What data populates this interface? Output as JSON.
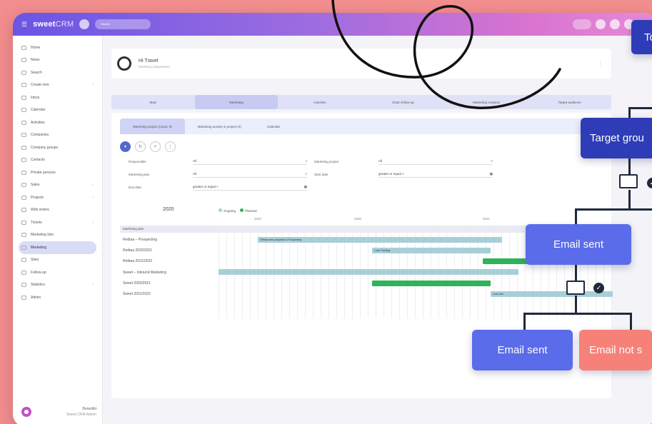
{
  "app": {
    "brand_bold": "sweet",
    "brand_light": "CRM",
    "search_placeholder": "Search"
  },
  "sidebar": {
    "items": [
      {
        "label": "Home"
      },
      {
        "label": "News"
      },
      {
        "label": "Search"
      },
      {
        "label": "Create new"
      },
      {
        "label": "Inbox"
      },
      {
        "label": "Calendar"
      },
      {
        "label": "Activities"
      },
      {
        "label": "Companies"
      },
      {
        "label": "Company groups"
      },
      {
        "label": "Contacts"
      },
      {
        "label": "Private persons"
      },
      {
        "label": "Sales"
      },
      {
        "label": "Projects"
      },
      {
        "label": "Web orders"
      },
      {
        "label": "Tickets"
      },
      {
        "label": "Marketing lists"
      },
      {
        "label": "Marketing"
      },
      {
        "label": "Sites"
      },
      {
        "label": "Follow-up"
      },
      {
        "label": "Statistics"
      },
      {
        "label": "Admin"
      }
    ],
    "user_name": "Benedikt",
    "user_sub": "Sweet CRM Admin"
  },
  "header": {
    "title": "Hi Travel",
    "subtitle": "Marketing department"
  },
  "tabs": [
    "Main",
    "Marketing",
    "Activities",
    "Chain follow-up",
    "Marketing contacts",
    "Target audience"
  ],
  "subtabs": [
    "Marketing project (count: 6)",
    "Marketing activity in project (4)",
    "Calendar"
  ],
  "filters": {
    "responsible_label": "Responsible",
    "responsible_value": "All",
    "project_label": "Marketing project",
    "project_value": "All",
    "plan_label": "Marketing plan",
    "plan_value": "All",
    "start_label": "Start date",
    "start_value": "greater or equal >",
    "end_label": "End date",
    "end_value": "greater or equal >"
  },
  "gantt": {
    "year": "2020",
    "legend": [
      "Ongoing",
      "Planned"
    ],
    "header": "Marketing plan",
    "ruler": [
      "2020",
      "2020",
      "2021"
    ],
    "rows": [
      "Retbaa – Prospecting",
      "Retbaa 2020/2021",
      "Retbaa 2021/2022",
      "Sweet – Inbound Marketing",
      "Sweet 2020/2021",
      "Sweet 2021/2022"
    ],
    "bars": [
      {
        "row": 0,
        "start": 0.1,
        "end": 0.72,
        "type": "ongoing",
        "label": "Retbaa new prospects in Prospecting"
      },
      {
        "row": 1,
        "start": 0.39,
        "end": 0.69,
        "type": "ongoing",
        "label": "Lead Tracking"
      },
      {
        "row": 2,
        "start": 0.67,
        "end": 1.0,
        "type": "planned",
        "label": ""
      },
      {
        "row": 3,
        "start": 0.0,
        "end": 0.76,
        "type": "ongoing",
        "label": ""
      },
      {
        "row": 4,
        "start": 0.39,
        "end": 0.69,
        "type": "planned",
        "label": ""
      },
      {
        "row": 5,
        "start": 0.69,
        "end": 1.0,
        "type": "ongoing",
        "label": "Lead Gen"
      }
    ]
  },
  "flow": {
    "top_node": "To",
    "target_node": "Target grou",
    "email_sent_1": "Email sent",
    "email_sent_2": "Email sent",
    "email_not_sent": "Email not s"
  },
  "colors": {
    "background": "#f38e8e",
    "node_dark": "#2f3cb8",
    "node_mid": "#5a6cea",
    "node_red": "#f68178",
    "ongoing": "#a7cfd8",
    "planned": "#2fb35a"
  }
}
